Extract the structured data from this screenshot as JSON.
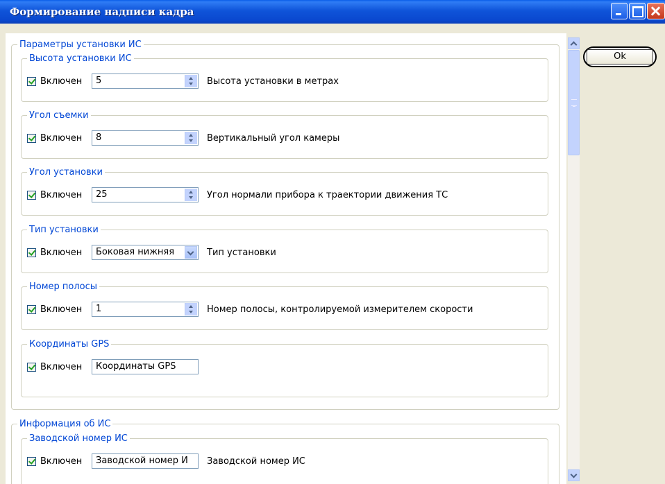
{
  "window": {
    "title": "Формирование надписи кадра",
    "ok_label": "Ok"
  },
  "main": {
    "group_params": "Параметры установки ИС",
    "group_info": "Информация об ИС",
    "enabled_label": "Включен",
    "sections": [
      {
        "title": "Высота установки ИС",
        "value": "5",
        "description": "Высота установки в метрах"
      },
      {
        "title": "Угол съемки",
        "value": "8",
        "description": "Вертикальный угол камеры"
      },
      {
        "title": "Угол установки",
        "value": "25",
        "description": "Угол нормали прибора к траектории движения ТС"
      },
      {
        "title": "Тип установки",
        "value": "Боковая нижняя",
        "description": "Тип установки"
      },
      {
        "title": "Номер полосы",
        "value": "1",
        "description": "Номер полосы, контролируемой измерителем скорости"
      },
      {
        "title": "Координаты GPS",
        "value": "Координаты GPS",
        "description": ""
      },
      {
        "title": "Заводской номер ИС",
        "value": "Заводской номер И",
        "description": "Заводской номер ИС"
      }
    ]
  }
}
